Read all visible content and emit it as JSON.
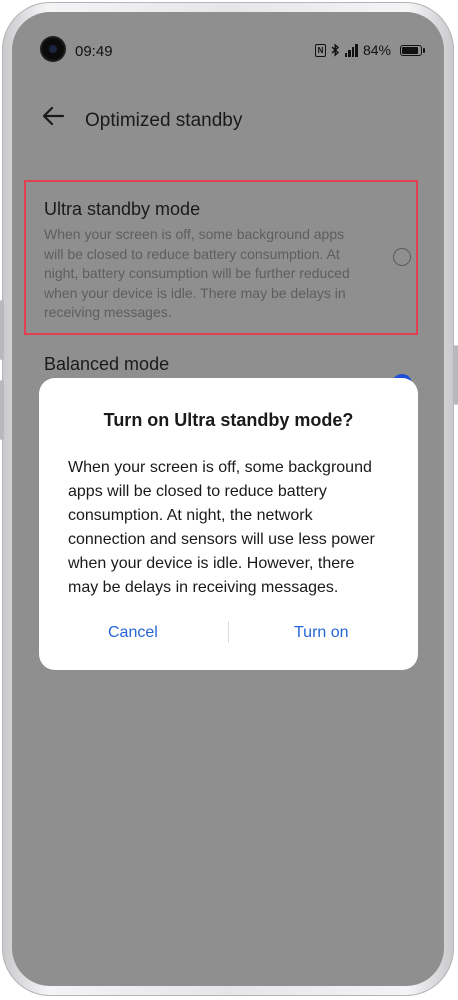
{
  "status_bar": {
    "time": "09:49",
    "battery": "84%",
    "icons": [
      "nfc-icon",
      "bluetooth-icon",
      "signal-icon",
      "battery-icon"
    ]
  },
  "header": {
    "title": "Optimized standby",
    "back_icon": "back-arrow-icon"
  },
  "options": {
    "ultra": {
      "title": "Ultra standby mode",
      "description_lines": [
        "When your screen is off, some background apps",
        "will be closed to reduce battery consumption. At",
        "night, battery consumption will be further reduced",
        "when your device is idle. There may be delays in",
        "receiving messages."
      ],
      "selected": false
    },
    "balanced": {
      "title": "Balanced mode",
      "selected": true
    }
  },
  "dialog": {
    "title": "Turn on Ultra standby mode?",
    "body_lines": [
      "When your screen is off, some background",
      "apps will be closed to reduce battery",
      "consumption. At night, the network",
      "connection and sensors will use less power",
      "when your device is idle. However, there",
      "may be delays in receiving messages."
    ],
    "cancel_label": "Cancel",
    "confirm_label": "Turn on"
  },
  "colors": {
    "accent": "#2766d6",
    "highlight_border": "#e0404f",
    "overlay_background": "#8f8f8f",
    "radio_selected": "#1c4ed8"
  }
}
